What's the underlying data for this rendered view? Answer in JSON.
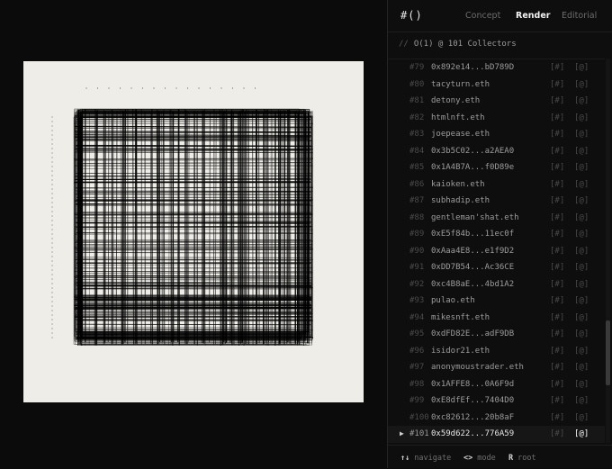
{
  "app": {
    "logo": "#()"
  },
  "tabs": [
    {
      "label": "Concept"
    },
    {
      "label": "Render"
    },
    {
      "label": "Editorial"
    }
  ],
  "active_tab": "Render",
  "subheader": {
    "comment": "//",
    "text": "O(1) @ 101 Collectors"
  },
  "collectors": [
    {
      "index": "#79",
      "name": "0x892e14...bD789D"
    },
    {
      "index": "#80",
      "name": "tacyturn.eth"
    },
    {
      "index": "#81",
      "name": "detony.eth"
    },
    {
      "index": "#82",
      "name": "htmlnft.eth"
    },
    {
      "index": "#83",
      "name": "joepease.eth"
    },
    {
      "index": "#84",
      "name": "0x3b5C02...a2AEA0"
    },
    {
      "index": "#85",
      "name": "0x1A4B7A...f0D89e"
    },
    {
      "index": "#86",
      "name": "kaioken.eth"
    },
    {
      "index": "#87",
      "name": "subhadip.eth"
    },
    {
      "index": "#88",
      "name": "gentleman'shat.eth"
    },
    {
      "index": "#89",
      "name": "0xE5f84b...11ec0f"
    },
    {
      "index": "#90",
      "name": "0xAaa4E8...e1f9D2"
    },
    {
      "index": "#91",
      "name": "0xDD7B54...Ac36CE"
    },
    {
      "index": "#92",
      "name": "0xc4B8aE...4bd1A2"
    },
    {
      "index": "#93",
      "name": "pulao.eth"
    },
    {
      "index": "#94",
      "name": "mikesnft.eth"
    },
    {
      "index": "#95",
      "name": "0xdFD82E...adF9DB"
    },
    {
      "index": "#96",
      "name": "isidor21.eth"
    },
    {
      "index": "#97",
      "name": "anonymoustrader.eth"
    },
    {
      "index": "#98",
      "name": "0x1AFFE8...0A6F9d"
    },
    {
      "index": "#99",
      "name": "0xE8dfEf...7404D0"
    },
    {
      "index": "#100",
      "name": "0xc82612...20b8aF"
    },
    {
      "index": "#101",
      "name": "0x59d622...776A59"
    }
  ],
  "selected_index": "#101",
  "row_actions": {
    "hash": "[#]",
    "at": "[@]",
    "at_selected": "[@]"
  },
  "scroll": {
    "position_fraction": 0.82
  },
  "footer": {
    "navigate": {
      "keys": "↑↓",
      "label": "navigate"
    },
    "mode": {
      "keys": "<>",
      "label": "mode"
    },
    "root": {
      "keys": "R",
      "label": "root"
    }
  },
  "colors": {
    "background": "#0b0b0b",
    "canvas": "#efede8",
    "ink": "#000000",
    "panel": "#0e0e0e"
  }
}
